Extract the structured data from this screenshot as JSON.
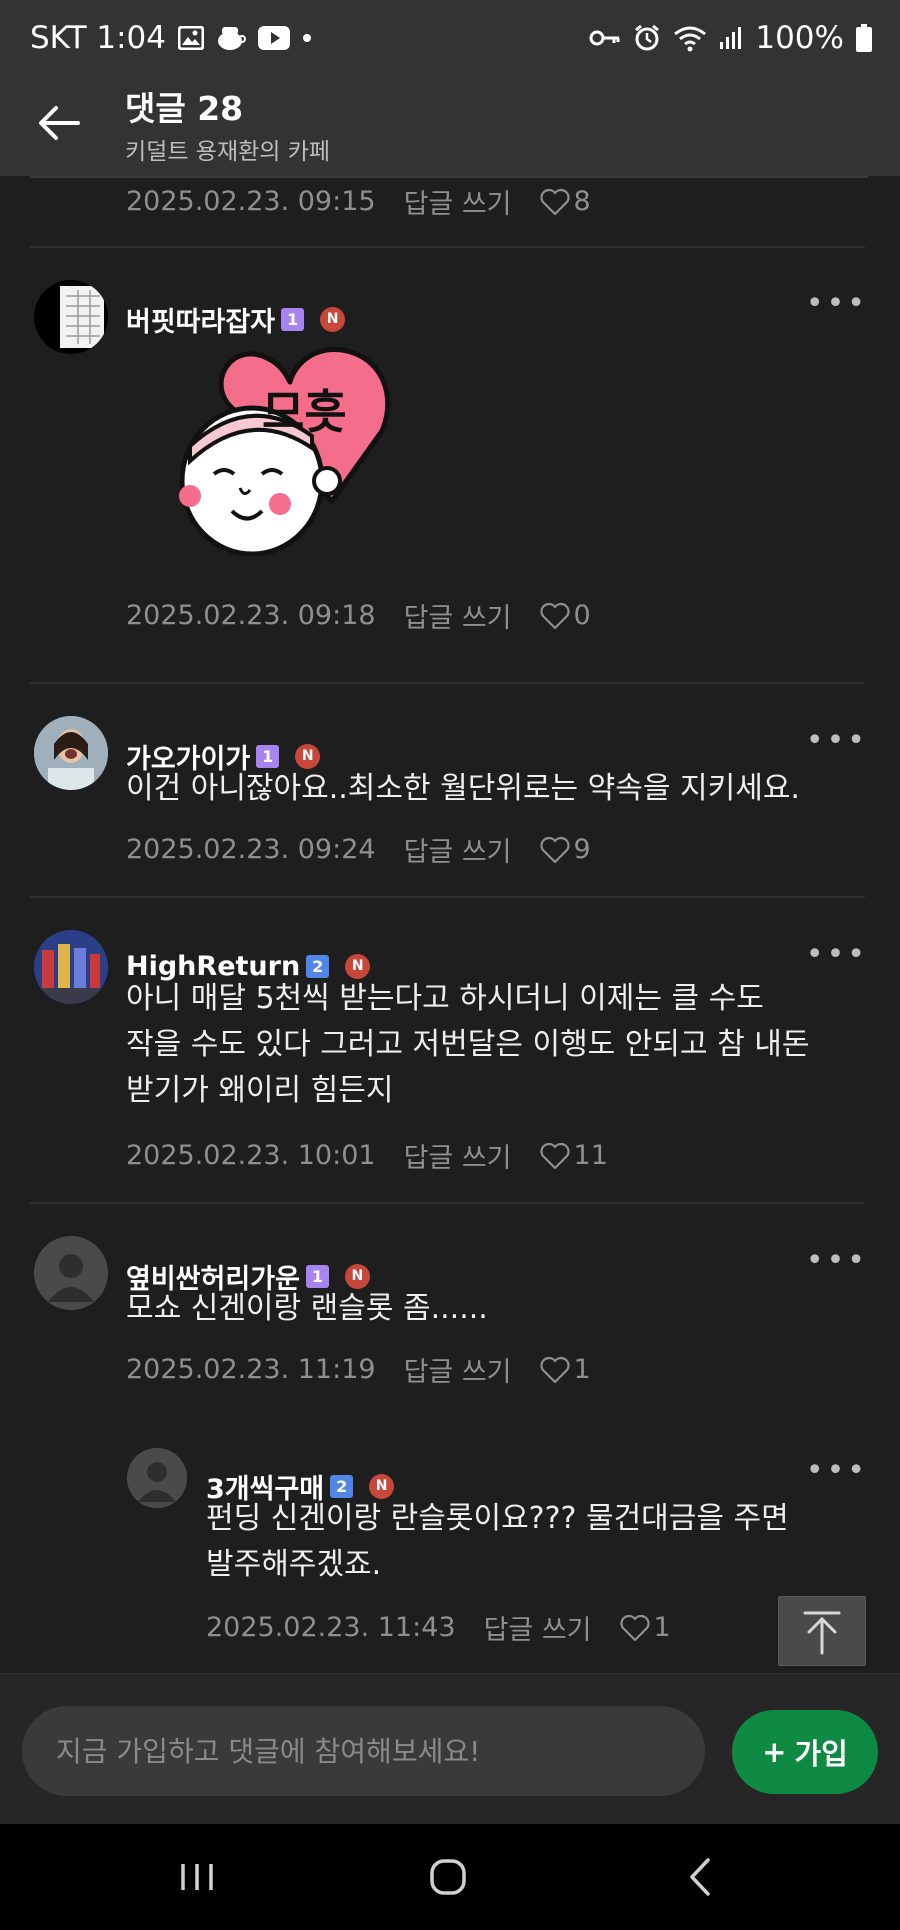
{
  "status_bar": {
    "carrier_time": "SKT 1:04",
    "battery": "100%",
    "icons_left": [
      "gallery-icon",
      "cup-icon",
      "youtube-icon",
      "dot-icon"
    ],
    "icons_right": [
      "key-icon",
      "alarm-icon",
      "wifi-icon",
      "signal-icon",
      "battery-icon"
    ]
  },
  "header": {
    "title": "댓글 28",
    "subtitle": "키덜트 용재환의 카페"
  },
  "first_partial": {
    "date": "2025.02.23. 09:15",
    "reply": "답글 쓰기",
    "likes": "8"
  },
  "comments": [
    {
      "author": "버핏따라잡자",
      "level": "1",
      "badge": "N",
      "sticker": "므흣",
      "date": "2025.02.23. 09:18",
      "reply": "답글 쓰기",
      "likes": "0"
    },
    {
      "author": "가오가이가",
      "level": "1",
      "badge": "N",
      "text": "이건 아니잖아요..최소한 월단위로는 약속을 지키세요.",
      "date": "2025.02.23. 09:24",
      "reply": "답글 쓰기",
      "likes": "9"
    },
    {
      "author": "HighReturn",
      "level": "2",
      "badge": "N",
      "text_lines": [
        "아니 매달 5천씩 받는다고 하시더니 이제는 클 수도",
        "작을 수도 있다 그러고 저번달은 이행도 안되고 참 내돈",
        "받기가 왜이리 힘든지"
      ],
      "date": "2025.02.23. 10:01",
      "reply": "답글 쓰기",
      "likes": "11"
    },
    {
      "author": "옆비싼허리가운",
      "level": "1",
      "badge": "N",
      "text": "모쇼 신겐이랑 랜슬롯 좀......",
      "date": "2025.02.23. 11:19",
      "reply": "답글 쓰기",
      "likes": "1"
    },
    {
      "author": "3개씩구매",
      "level": "2",
      "badge": "N",
      "text_lines": [
        "펀딩 신겐이랑 란슬롯이요??? 물건대금을 주면",
        "발주해주겠죠."
      ],
      "date": "2025.02.23. 11:43",
      "reply": "답글 쓰기",
      "likes": "1"
    }
  ],
  "more_label": "•••",
  "input": {
    "placeholder": "지금 가입하고 댓글에 참여해보세요!"
  },
  "join_button": {
    "plus": "+",
    "label": "가입"
  },
  "colors": {
    "background": "#1e1e1e",
    "header": "#333333",
    "join_green": "#0e8a43",
    "level1": "#a784f0",
    "level2": "#4f86e8",
    "new_badge": "#c7483a"
  }
}
